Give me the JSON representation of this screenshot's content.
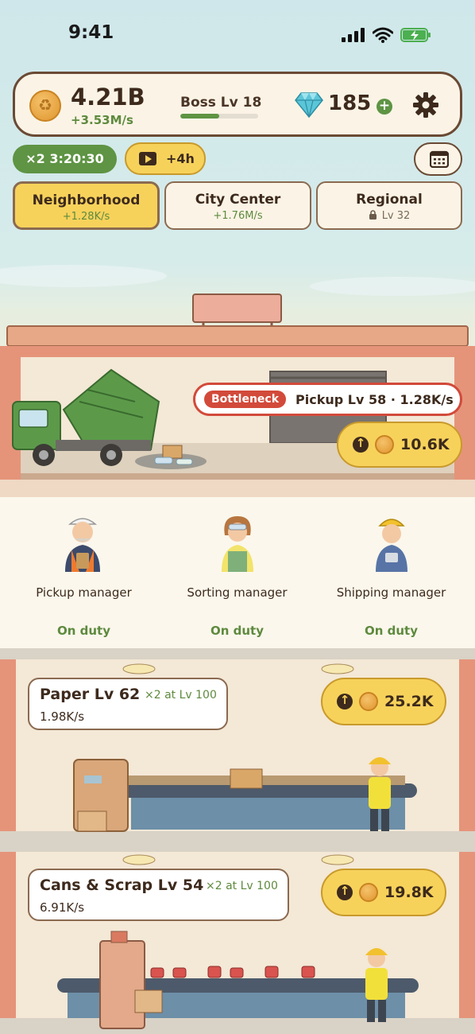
{
  "status_bar": {
    "time": "9:41"
  },
  "header": {
    "money": "4.21B",
    "money_rate": "+3.53M/s",
    "boss_label": "Boss Lv 18",
    "boss_progress": 0.5,
    "gems": "185",
    "gem_plus": "+"
  },
  "boosts": {
    "multiplier_timer": "×2 3:20:30",
    "video_reward": "+4h"
  },
  "tabs": [
    {
      "name": "Neighborhood",
      "sub": "+1.28K/s",
      "active": true
    },
    {
      "name": "City Center",
      "sub": "+1.76M/s",
      "active": false
    },
    {
      "name": "Regional",
      "sub": "Lv 32",
      "locked": true
    }
  ],
  "pickup": {
    "tag": "Bottleneck",
    "text": "Pickup Lv 58 · 1.28K/s",
    "upgrade_cost": "10.6K"
  },
  "managers": [
    {
      "name": "Pickup manager",
      "status": "On duty"
    },
    {
      "name": "Sorting manager",
      "status": "On duty"
    },
    {
      "name": "Shipping manager",
      "status": "On duty"
    }
  ],
  "floors": [
    {
      "title": "Paper  Lv 62",
      "bonus": "×2 at Lv 100",
      "rate": "1.98K/s",
      "upgrade_cost": "25.2K"
    },
    {
      "title": "Cans & Scrap  Lv 54",
      "bonus": "×2 at Lv 100",
      "rate": "6.91K/s",
      "upgrade_cost": "19.8K"
    }
  ],
  "colors": {
    "accent_green": "#5e9443",
    "accent_yellow": "#f7d25b",
    "bottleneck_red": "#d24a3a",
    "panel_border": "#6a4a34"
  }
}
